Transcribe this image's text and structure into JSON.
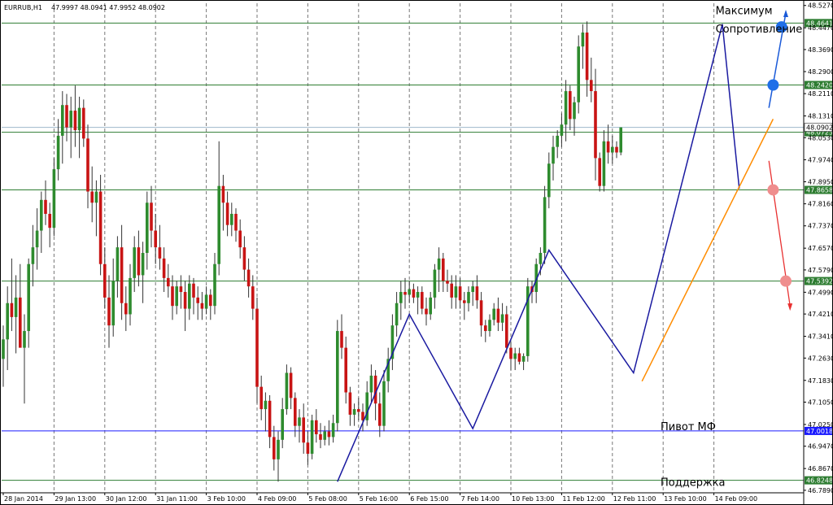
{
  "chart_data": {
    "type": "candlestick",
    "symbol_header": "EURRUB,H1",
    "ohlc_header": "47.9997 48.0941 47.9952 48.0902",
    "ylim": [
      46.78,
      48.535
    ],
    "y_ticks": [
      "48.5270",
      "48.4470",
      "48.3690",
      "48.2900",
      "48.2110",
      "48.1310",
      "48.0530",
      "47.9740",
      "47.8950",
      "47.8160",
      "47.7370",
      "47.6570",
      "47.5790",
      "47.4990",
      "47.4210",
      "47.3410",
      "47.2630",
      "47.1830",
      "47.1050",
      "47.0250",
      "46.9470",
      "46.8670",
      "46.7890"
    ],
    "y_tick_values": [
      48.527,
      48.447,
      48.369,
      48.29,
      48.211,
      48.131,
      48.053,
      47.974,
      47.895,
      47.816,
      47.737,
      47.657,
      47.579,
      47.499,
      47.421,
      47.341,
      47.263,
      47.183,
      47.105,
      47.025,
      46.947,
      46.867,
      46.789
    ],
    "x_labels": [
      "28 Jan 2014",
      "29 Jan 13:00",
      "30 Jan 12:00",
      "31 Jan 11:00",
      "3 Feb 10:00",
      "4 Feb 09:00",
      "5 Feb 08:00",
      "5 Feb 16:00",
      "6 Feb 15:00",
      "7 Feb 14:00",
      "10 Feb 13:00",
      "11 Feb 12:00",
      "12 Feb 11:00",
      "13 Feb 10:00",
      "14 Feb 09:00"
    ],
    "x_label_index": [
      0,
      12,
      24,
      36,
      48,
      60,
      72,
      84,
      96,
      108,
      120,
      132,
      144,
      156,
      168
    ],
    "horizontal_levels": [
      {
        "value": 48.4641,
        "label": "48.4641",
        "color": "#2e7d32"
      },
      {
        "value": 48.242,
        "label": "48.2420",
        "color": "#2e7d32"
      },
      {
        "value": 48.0725,
        "label": "48.0725",
        "color": "#2e7d32"
      },
      {
        "value": 47.8658,
        "label": "47.8658",
        "color": "#2e7d32"
      },
      {
        "value": 47.5392,
        "label": "47.5392",
        "color": "#2e7d32"
      },
      {
        "value": 47.0018,
        "label": "47.0018",
        "color": "#1a1aff"
      },
      {
        "value": 46.8248,
        "label": "46.8248",
        "color": "#2e7d32"
      }
    ],
    "current_price": {
      "value": 48.0902,
      "label": "48.0902"
    },
    "annotations": [
      {
        "text": "Максимум",
        "price": 48.495,
        "bar": 183
      },
      {
        "text": "Сопротивление",
        "price": 48.43,
        "bar": 183
      },
      {
        "text": "Пивот МФ",
        "price": 47.005,
        "bar": 170
      },
      {
        "text": "Поддержка",
        "price": 46.805,
        "bar": 170
      }
    ],
    "zigzag": [
      [
        79,
        46.82
      ],
      [
        96,
        47.42
      ],
      [
        111,
        47.01
      ],
      [
        129,
        47.65
      ],
      [
        149,
        47.21
      ],
      [
        170,
        48.46
      ],
      [
        174,
        47.87
      ]
    ],
    "trendline": [
      [
        151,
        47.18
      ],
      [
        182,
        48.12
      ]
    ],
    "projection_up": {
      "points": [
        [
          181,
          48.16
        ],
        [
          185,
          48.5
        ]
      ],
      "markers": [
        [
          182,
          48.242
        ],
        [
          184,
          48.45
        ]
      ]
    },
    "projection_down": {
      "points": [
        [
          181,
          47.97
        ],
        [
          186,
          47.45
        ]
      ],
      "markers": [
        [
          182,
          47.866
        ],
        [
          185,
          47.539
        ]
      ]
    },
    "candles": [
      [
        47.26,
        47.38,
        47.16,
        47.33
      ],
      [
        47.33,
        47.52,
        47.22,
        47.46
      ],
      [
        47.46,
        47.62,
        47.36,
        47.41
      ],
      [
        47.41,
        47.56,
        47.28,
        47.48
      ],
      [
        47.48,
        47.6,
        47.38,
        47.3
      ],
      [
        47.3,
        47.42,
        47.1,
        47.36
      ],
      [
        47.36,
        47.62,
        47.3,
        47.6
      ],
      [
        47.6,
        47.74,
        47.52,
        47.66
      ],
      [
        47.66,
        47.8,
        47.58,
        47.72
      ],
      [
        47.72,
        47.86,
        47.64,
        47.83
      ],
      [
        47.83,
        47.9,
        47.74,
        47.78
      ],
      [
        47.78,
        47.82,
        47.66,
        47.73
      ],
      [
        47.73,
        47.98,
        47.7,
        47.94
      ],
      [
        47.94,
        48.12,
        47.9,
        48.06
      ],
      [
        48.06,
        48.22,
        47.96,
        48.17
      ],
      [
        48.17,
        48.21,
        48.04,
        48.09
      ],
      [
        48.09,
        48.2,
        47.98,
        48.15
      ],
      [
        48.15,
        48.24,
        48.02,
        48.08
      ],
      [
        48.08,
        48.2,
        47.98,
        48.16
      ],
      [
        48.16,
        48.19,
        48.02,
        48.05
      ],
      [
        48.05,
        48.1,
        47.8,
        47.86
      ],
      [
        47.86,
        47.95,
        47.75,
        47.82
      ],
      [
        47.82,
        47.9,
        47.7,
        47.86
      ],
      [
        47.86,
        47.92,
        47.56,
        47.6
      ],
      [
        47.6,
        47.66,
        47.44,
        47.48
      ],
      [
        47.48,
        47.56,
        47.3,
        47.38
      ],
      [
        47.38,
        47.62,
        47.34,
        47.54
      ],
      [
        47.54,
        47.7,
        47.48,
        47.66
      ],
      [
        47.66,
        47.74,
        47.4,
        47.46
      ],
      [
        47.46,
        47.52,
        47.36,
        47.42
      ],
      [
        47.42,
        47.6,
        47.38,
        47.55
      ],
      [
        47.55,
        47.7,
        47.5,
        47.66
      ],
      [
        47.66,
        47.72,
        47.52,
        47.56
      ],
      [
        47.56,
        47.68,
        47.46,
        47.64
      ],
      [
        47.64,
        47.86,
        47.58,
        47.82
      ],
      [
        47.82,
        47.88,
        47.66,
        47.72
      ],
      [
        47.72,
        47.78,
        47.6,
        47.66
      ],
      [
        47.66,
        47.74,
        47.58,
        47.62
      ],
      [
        47.62,
        47.66,
        47.5,
        47.55
      ],
      [
        47.55,
        47.6,
        47.48,
        47.52
      ],
      [
        47.52,
        47.56,
        47.4,
        47.45
      ],
      [
        47.45,
        47.54,
        47.42,
        47.52
      ],
      [
        47.52,
        47.56,
        47.44,
        47.5
      ],
      [
        47.5,
        47.54,
        47.36,
        47.44
      ],
      [
        47.44,
        47.56,
        47.4,
        47.53
      ],
      [
        47.53,
        47.55,
        47.42,
        47.48
      ],
      [
        47.48,
        47.52,
        47.4,
        47.46
      ],
      [
        47.46,
        47.5,
        47.4,
        47.44
      ],
      [
        47.44,
        47.52,
        47.42,
        47.49
      ],
      [
        47.49,
        47.51,
        47.4,
        47.45
      ],
      [
        47.45,
        47.64,
        47.42,
        47.6
      ],
      [
        47.6,
        48.04,
        47.56,
        47.88
      ],
      [
        47.88,
        47.92,
        47.72,
        47.82
      ],
      [
        47.82,
        47.86,
        47.7,
        47.74
      ],
      [
        47.74,
        47.82,
        47.7,
        47.78
      ],
      [
        47.78,
        47.8,
        47.68,
        47.72
      ],
      [
        47.72,
        47.76,
        47.62,
        47.66
      ],
      [
        47.66,
        47.7,
        47.54,
        47.58
      ],
      [
        47.58,
        47.62,
        47.48,
        47.52
      ],
      [
        47.52,
        47.56,
        47.4,
        47.44
      ],
      [
        47.44,
        47.48,
        47.1,
        47.16
      ],
      [
        47.16,
        47.2,
        47.04,
        47.08
      ],
      [
        47.08,
        47.14,
        47.0,
        47.11
      ],
      [
        47.11,
        47.13,
        46.94,
        46.98
      ],
      [
        46.98,
        47.02,
        46.86,
        46.9
      ],
      [
        46.9,
        47.0,
        46.82,
        46.97
      ],
      [
        46.97,
        47.12,
        46.94,
        47.08
      ],
      [
        47.08,
        47.24,
        47.06,
        47.21
      ],
      [
        47.21,
        47.23,
        47.08,
        47.12
      ],
      [
        47.12,
        47.14,
        46.98,
        47.02
      ],
      [
        47.02,
        47.08,
        46.96,
        47.05
      ],
      [
        47.05,
        47.1,
        46.92,
        46.96
      ],
      [
        46.96,
        47.0,
        46.88,
        46.92
      ],
      [
        46.92,
        47.06,
        46.9,
        47.04
      ],
      [
        47.04,
        47.08,
        46.96,
        46.99
      ],
      [
        46.99,
        47.03,
        46.94,
        46.97
      ],
      [
        46.97,
        47.02,
        46.95,
        47.0
      ],
      [
        47.0,
        47.04,
        46.95,
        46.98
      ],
      [
        46.98,
        47.06,
        46.96,
        47.03
      ],
      [
        47.03,
        47.4,
        47.0,
        47.36
      ],
      [
        47.36,
        47.42,
        47.26,
        47.3
      ],
      [
        47.3,
        47.34,
        47.1,
        47.14
      ],
      [
        47.14,
        47.16,
        47.02,
        47.06
      ],
      [
        47.06,
        47.1,
        47.02,
        47.08
      ],
      [
        47.08,
        47.12,
        47.04,
        47.07
      ],
      [
        47.07,
        47.1,
        47.0,
        47.04
      ],
      [
        47.04,
        47.18,
        47.02,
        47.14
      ],
      [
        47.14,
        47.24,
        47.1,
        47.2
      ],
      [
        47.2,
        47.22,
        47.04,
        47.1
      ],
      [
        47.1,
        47.14,
        46.98,
        47.02
      ],
      [
        47.02,
        47.22,
        47.0,
        47.18
      ],
      [
        47.18,
        47.3,
        47.14,
        47.26
      ],
      [
        47.26,
        47.42,
        47.22,
        47.38
      ],
      [
        47.38,
        47.5,
        47.34,
        47.46
      ],
      [
        47.46,
        47.54,
        47.4,
        47.5
      ],
      [
        47.5,
        47.55,
        47.44,
        47.49
      ],
      [
        47.49,
        47.54,
        47.46,
        47.51
      ],
      [
        47.51,
        47.53,
        47.46,
        47.48
      ],
      [
        47.48,
        47.52,
        47.42,
        47.5
      ],
      [
        47.5,
        47.52,
        47.42,
        47.44
      ],
      [
        47.44,
        47.48,
        47.38,
        47.42
      ],
      [
        47.42,
        47.5,
        47.4,
        47.48
      ],
      [
        47.48,
        47.6,
        47.44,
        47.58
      ],
      [
        47.58,
        47.66,
        47.5,
        47.62
      ],
      [
        47.62,
        47.64,
        47.5,
        47.54
      ],
      [
        47.54,
        47.58,
        47.5,
        47.53
      ],
      [
        47.53,
        47.56,
        47.44,
        47.48
      ],
      [
        47.48,
        47.56,
        47.44,
        47.52
      ],
      [
        47.52,
        47.55,
        47.44,
        47.47
      ],
      [
        47.47,
        47.5,
        47.4,
        47.46
      ],
      [
        47.46,
        47.52,
        47.43,
        47.5
      ],
      [
        47.5,
        47.54,
        47.45,
        47.52
      ],
      [
        47.52,
        47.56,
        47.44,
        47.47
      ],
      [
        47.47,
        47.5,
        47.34,
        47.38
      ],
      [
        47.38,
        47.4,
        47.32,
        47.36
      ],
      [
        47.36,
        47.42,
        47.34,
        47.4
      ],
      [
        47.4,
        47.46,
        47.38,
        47.44
      ],
      [
        47.44,
        47.48,
        47.36,
        47.39
      ],
      [
        47.39,
        47.46,
        47.36,
        47.42
      ],
      [
        47.42,
        47.45,
        47.28,
        47.3
      ],
      [
        47.3,
        47.32,
        47.22,
        47.26
      ],
      [
        47.26,
        47.3,
        47.22,
        47.28
      ],
      [
        47.28,
        47.3,
        47.24,
        47.25
      ],
      [
        47.25,
        47.28,
        47.22,
        47.27
      ],
      [
        47.27,
        47.55,
        47.25,
        47.52
      ],
      [
        47.52,
        47.54,
        47.46,
        47.5
      ],
      [
        47.5,
        47.62,
        47.46,
        47.6
      ],
      [
        47.6,
        47.66,
        47.56,
        47.64
      ],
      [
        47.64,
        47.88,
        47.6,
        47.84
      ],
      [
        47.84,
        48.0,
        47.8,
        47.96
      ],
      [
        47.96,
        48.06,
        47.9,
        48.02
      ],
      [
        48.02,
        48.08,
        47.98,
        48.06
      ],
      [
        48.06,
        48.14,
        48.02,
        48.1
      ],
      [
        48.1,
        48.26,
        48.04,
        48.22
      ],
      [
        48.22,
        48.24,
        48.08,
        48.12
      ],
      [
        48.12,
        48.2,
        48.06,
        48.18
      ],
      [
        48.18,
        48.42,
        48.14,
        48.38
      ],
      [
        48.38,
        48.46,
        48.3,
        48.43
      ],
      [
        48.43,
        48.47,
        48.2,
        48.26
      ],
      [
        48.26,
        48.34,
        48.18,
        48.22
      ],
      [
        48.22,
        48.3,
        47.9,
        47.98
      ],
      [
        47.98,
        48.0,
        47.86,
        47.88
      ],
      [
        47.88,
        48.08,
        47.86,
        48.04
      ],
      [
        48.04,
        48.1,
        47.96,
        48.0
      ],
      [
        48.0,
        48.06,
        47.96,
        48.02
      ],
      [
        48.02,
        48.04,
        47.98,
        48.0
      ],
      [
        48.0,
        48.09,
        47.99,
        48.09
      ]
    ]
  }
}
